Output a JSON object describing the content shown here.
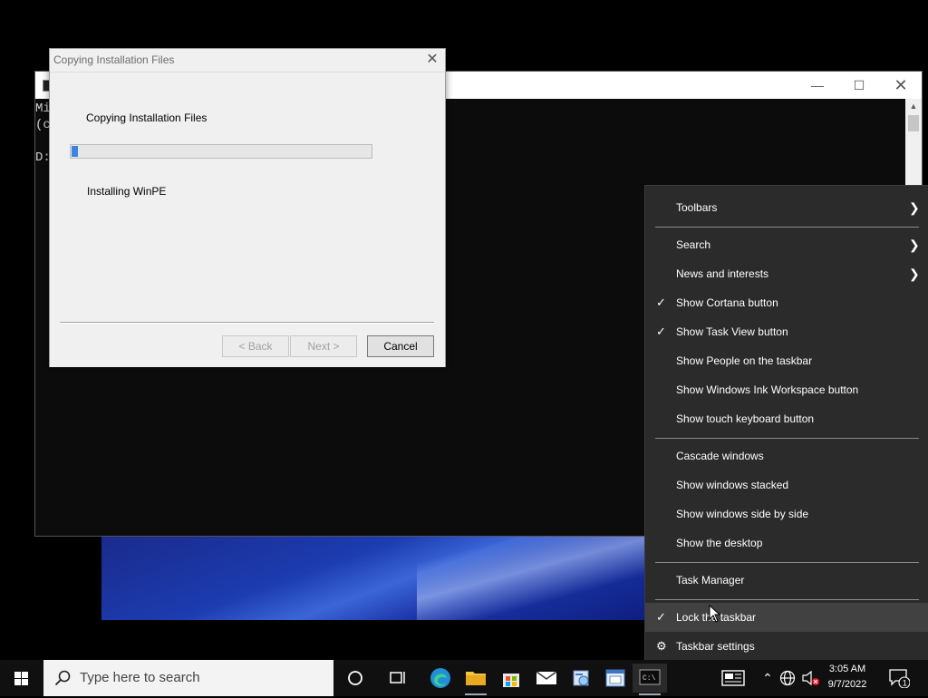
{
  "console": {
    "lines": "Mi\n(c\n\nD:"
  },
  "dialog": {
    "title": "Copying Installation Files",
    "heading": "Copying Installation Files",
    "progress": 0.02,
    "status": "Installing WinPE",
    "back_label": "< Back",
    "next_label": "Next >",
    "cancel_label": "Cancel"
  },
  "menu": {
    "items": [
      {
        "label": "Toolbars"
      },
      {
        "label": "Search"
      },
      {
        "label": "News and interests"
      },
      {
        "label": "Show Cortana button"
      },
      {
        "label": "Show Task View button"
      },
      {
        "label": "Show People on the taskbar"
      },
      {
        "label": "Show Windows Ink Workspace button"
      },
      {
        "label": "Show touch keyboard button"
      },
      {
        "label": "Cascade windows"
      },
      {
        "label": "Show windows stacked"
      },
      {
        "label": "Show windows side by side"
      },
      {
        "label": "Show the desktop"
      },
      {
        "label": "Task Manager"
      },
      {
        "label": "Lock the taskbar"
      },
      {
        "label": "Taskbar settings"
      }
    ],
    "checked": [
      "Show Cortana button",
      "Show Task View button",
      "Lock the taskbar"
    ]
  },
  "taskbar": {
    "search_placeholder": "Type here to search",
    "time": "3:05 AM",
    "date": "9/7/2022",
    "notification_count": "1"
  },
  "colors": {
    "accent": "#3c84e0",
    "menu_bg": "#2b2b2b",
    "taskbar_bg": "#101010"
  }
}
